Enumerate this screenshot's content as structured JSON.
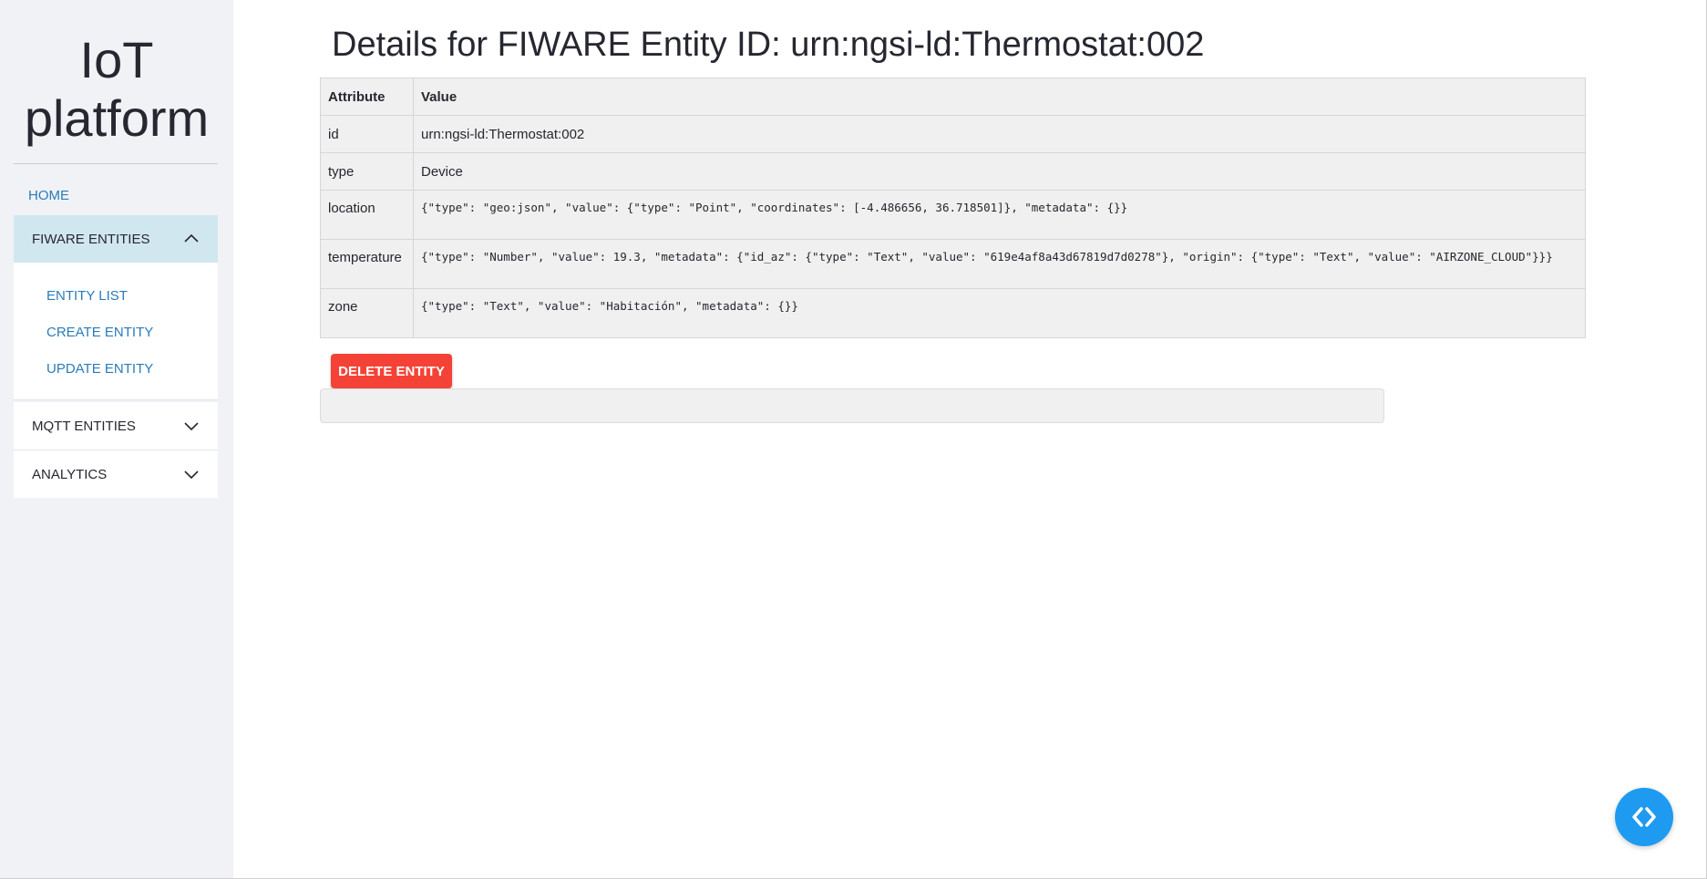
{
  "sidebar": {
    "brand_line1": "IoT",
    "brand_line2": "platform",
    "home": "HOME",
    "groups": [
      {
        "label": "FIWARE ENTITIES",
        "expanded": true
      },
      {
        "label": "MQTT ENTITIES",
        "expanded": false
      },
      {
        "label": "ANALYTICS",
        "expanded": false
      }
    ],
    "sub_items": [
      "ENTITY LIST",
      "CREATE ENTITY",
      "UPDATE ENTITY"
    ]
  },
  "main": {
    "title": "Details for FIWARE Entity ID: urn:ngsi-ld:Thermostat:002",
    "table": {
      "headers": [
        "Attribute",
        "Value"
      ],
      "rows": [
        {
          "attribute": "id",
          "value": "urn:ngsi-ld:Thermostat:002"
        },
        {
          "attribute": "type",
          "value": "Device"
        },
        {
          "attribute": "location",
          "value": "{\"type\": \"geo:json\", \"value\": {\"type\": \"Point\", \"coordinates\": [-4.486656, 36.718501]}, \"metadata\": {}}"
        },
        {
          "attribute": "temperature",
          "value": "{\"type\": \"Number\", \"value\": 19.3, \"metadata\": {\"id_az\": {\"type\": \"Text\", \"value\": \"619e4af8a43d67819d7d0278\"}, \"origin\": {\"type\": \"Text\", \"value\": \"AIRZONE_CLOUD\"}}}"
        },
        {
          "attribute": "zone",
          "value": "{\"type\": \"Text\", \"value\": \"Habitación\", \"metadata\": {}}"
        }
      ]
    },
    "delete_button": "DELETE ENTITY"
  },
  "colors": {
    "sidebar_bg": "#f0f2f6",
    "active_group_bg": "#d1e7f0",
    "link": "#2b7bb9",
    "danger": "#f44336",
    "fab": "#1e9bf0"
  },
  "icons": {
    "group_expanded": "chevron-up-icon",
    "group_collapsed": "chevron-down-icon",
    "fab": "code-icon"
  }
}
